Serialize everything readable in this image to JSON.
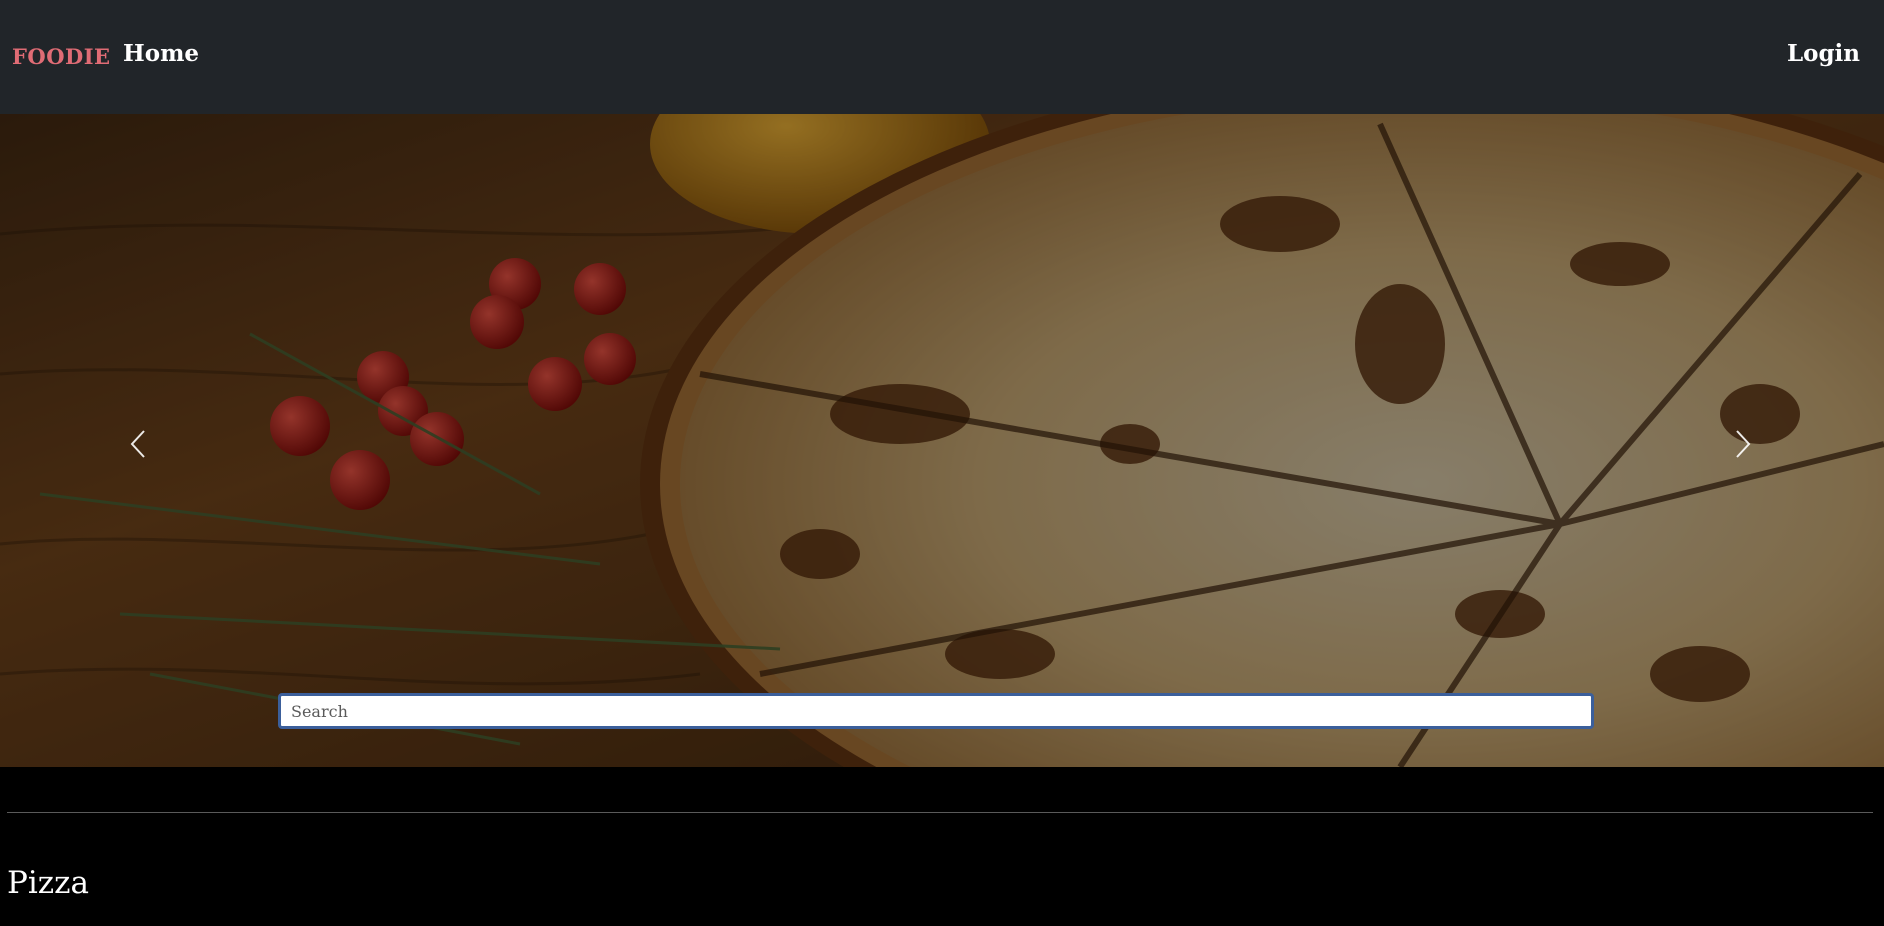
{
  "navbar": {
    "brand": "FOODIE",
    "home_label": "Home",
    "login_label": "Login",
    "brand_color": "#e06c75",
    "background_color": "#212529"
  },
  "hero": {
    "image_subject": "pizza-on-wooden-board",
    "prev_icon": "chevron-left-icon",
    "next_icon": "chevron-right-icon",
    "search": {
      "placeholder": "Search",
      "value": ""
    }
  },
  "section": {
    "title": "Pizza"
  }
}
